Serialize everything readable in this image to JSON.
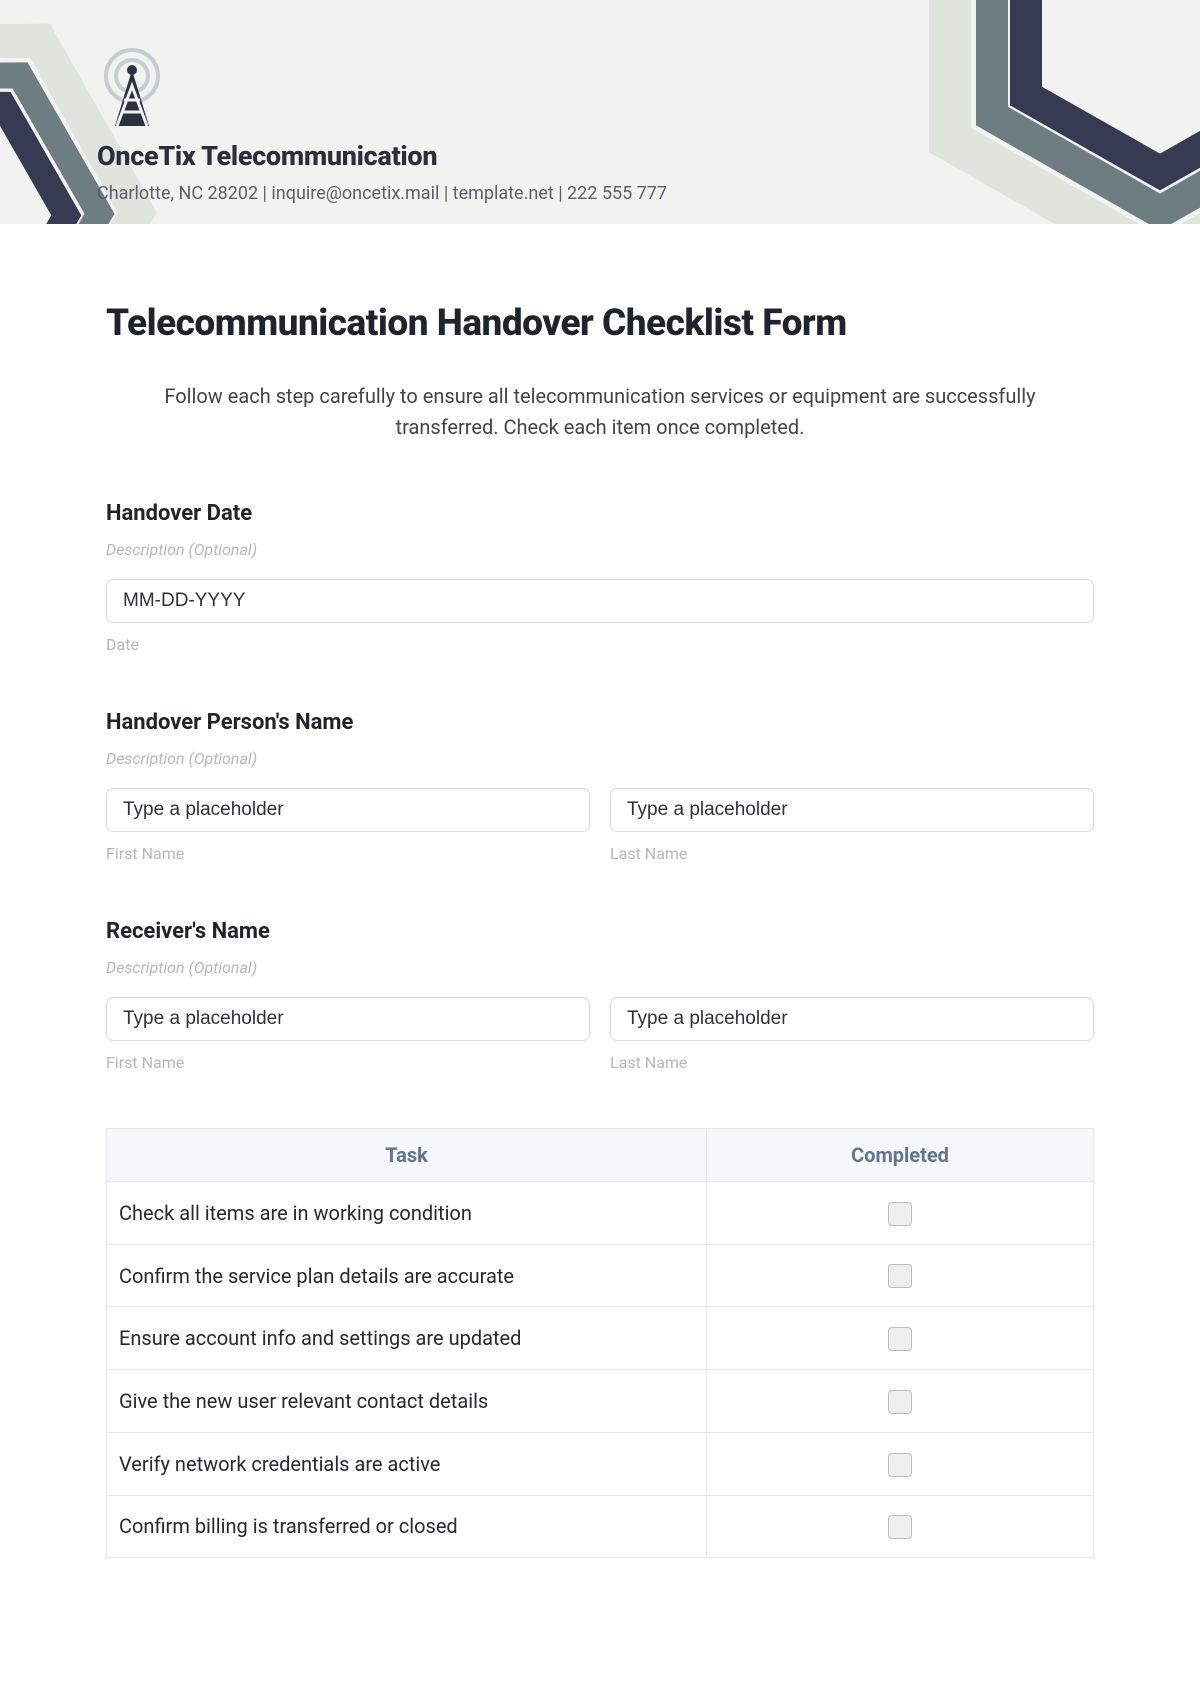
{
  "header": {
    "company_name": "OnceTix Telecommunication",
    "info_line": "Charlotte, NC 28202 | inquire@oncetix.mail | template.net | 222 555 777"
  },
  "page": {
    "title": "Telecommunication Handover Checklist Form",
    "subtitle": "Follow each step carefully to ensure all telecommunication services or equipment are successfully transferred. Check each item once completed."
  },
  "sections": {
    "handover_date": {
      "label": "Handover Date",
      "desc": "Description (Optional)",
      "date_placeholder": "MM-DD-YYYY",
      "date_help": "Date"
    },
    "handover_person": {
      "label": "Handover Person's Name",
      "desc": "Description (Optional)",
      "first_placeholder": "Type a placeholder",
      "last_placeholder": "Type a placeholder",
      "first_help": "First Name",
      "last_help": "Last Name"
    },
    "receiver": {
      "label": "Receiver's Name",
      "desc": "Description (Optional)",
      "first_placeholder": "Type a placeholder",
      "last_placeholder": "Type a placeholder",
      "first_help": "First Name",
      "last_help": "Last Name"
    }
  },
  "table": {
    "headers": {
      "task": "Task",
      "completed": "Completed"
    },
    "rows": [
      {
        "task": "Check all items are in working condition"
      },
      {
        "task": "Confirm the service plan details are accurate"
      },
      {
        "task": "Ensure account info and settings are updated"
      },
      {
        "task": "Give the new user relevant contact details"
      },
      {
        "task": "Verify network credentials are active"
      },
      {
        "task": "Confirm billing is transferred or closed"
      }
    ]
  }
}
